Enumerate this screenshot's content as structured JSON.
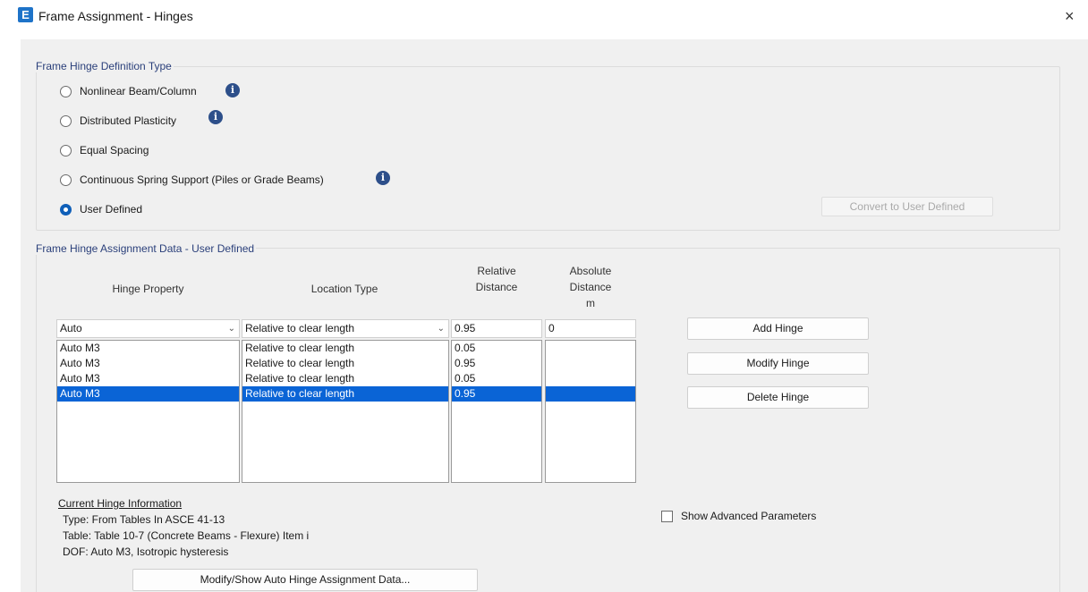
{
  "window": {
    "title": "Frame Assignment - Hinges",
    "app_icon_letter": "E",
    "close_glyph": "×"
  },
  "definition_type": {
    "group_title": "Frame Hinge Definition Type",
    "options": [
      {
        "label": "Nonlinear Beam/Column",
        "checked": false,
        "has_info": true
      },
      {
        "label": "Distributed Plasticity",
        "checked": false,
        "has_info": true
      },
      {
        "label": "Equal Spacing",
        "checked": false,
        "has_info": false
      },
      {
        "label": "Continuous Spring Support (Piles or Grade Beams)",
        "checked": false,
        "has_info": true
      },
      {
        "label": "User Defined",
        "checked": true,
        "has_info": false
      }
    ],
    "info_glyph": "i",
    "convert_button": "Convert to User Defined"
  },
  "assignment": {
    "group_title": "Frame Hinge Assignment Data - User Defined",
    "headers": {
      "hinge_property": "Hinge Property",
      "location_type": "Location Type",
      "relative_distance_1": "Relative",
      "relative_distance_2": "Distance",
      "absolute_distance_1": "Absolute",
      "absolute_distance_2": "Distance",
      "absolute_distance_unit": "m"
    },
    "inputs": {
      "hinge_property": "Auto",
      "location_type": "Relative to clear length",
      "relative_distance": "0.95",
      "absolute_distance": "0"
    },
    "rows": [
      {
        "hinge": "Auto  M3",
        "location": "Relative to clear length",
        "relative": "0.05",
        "absolute": ""
      },
      {
        "hinge": "Auto  M3",
        "location": "Relative to clear length",
        "relative": "0.95",
        "absolute": ""
      },
      {
        "hinge": "Auto  M3",
        "location": "Relative to clear length",
        "relative": "0.05",
        "absolute": ""
      },
      {
        "hinge": "Auto  M3",
        "location": "Relative to clear length",
        "relative": "0.95",
        "absolute": ""
      }
    ],
    "selected_row": 3,
    "buttons": {
      "add": "Add Hinge",
      "modify": "Modify Hinge",
      "delete": "Delete Hinge"
    },
    "current_info": {
      "heading": "Current Hinge Information",
      "type": "Type:  From Tables In ASCE 41-13",
      "table": "Table:  Table 10-7 (Concrete Beams - Flexure) Item i",
      "dof": "DOF:  Auto  M3, Isotropic hysteresis"
    },
    "show_advanced": {
      "label": "Show Advanced Parameters",
      "checked": false
    },
    "modify_auto_button": "Modify/Show Auto Hinge Assignment Data..."
  }
}
